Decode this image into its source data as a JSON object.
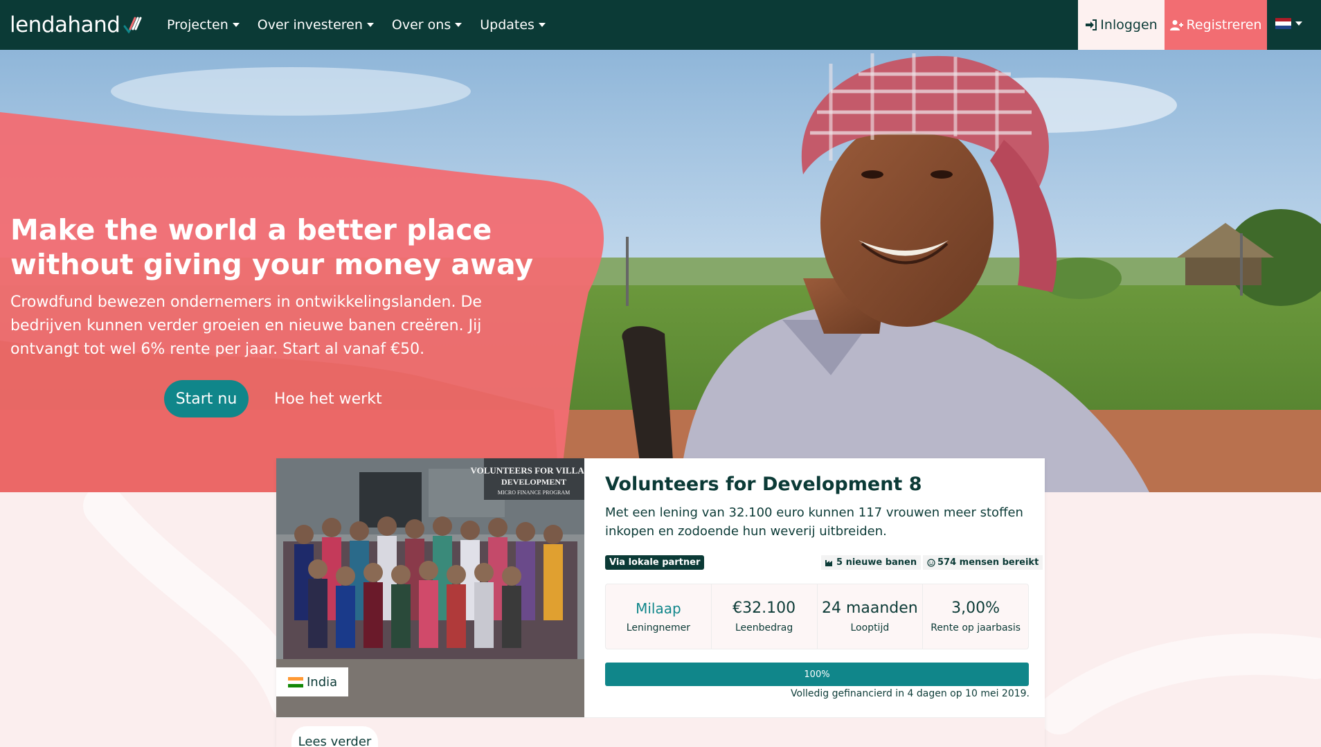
{
  "brand": {
    "name": "lendahand"
  },
  "nav": {
    "items": [
      {
        "label": "Projecten"
      },
      {
        "label": "Over investeren"
      },
      {
        "label": "Over ons"
      },
      {
        "label": "Updates"
      }
    ],
    "login": "Inloggen",
    "register": "Registreren",
    "language": "NL"
  },
  "hero": {
    "title": "Make the world a better place without giving your money away",
    "subtitle": "Crowdfund bewezen ondernemers in ontwikkelingslanden. De bedrijven kunnen verder groeien en nieuwe banen creëren. Jij ontvangt tot wel 6% rente per jaar. Start al vanaf €50.",
    "cta_primary": "Start nu",
    "cta_secondary": "Hoe het werkt"
  },
  "project": {
    "title": "Volunteers for Development 8",
    "description": "Met een lening van 32.100 euro kunnen 117 vrouwen meer stoffen inkopen en zodoende hun weverij uitbreiden.",
    "country": "India",
    "photo_sign_lines": [
      "VOLUNTEERS FOR VILLAGE",
      "DEVELOPMENT",
      "MICRO FINANCE PROGRAM"
    ],
    "badge_partner": "Via lokale partner",
    "badge_jobs": "5 nieuwe banen",
    "badge_reach": "574 mensen bereikt",
    "stats": [
      {
        "value": "Milaap",
        "label": "Leningnemer"
      },
      {
        "value": "€32.100",
        "label": "Leenbedrag"
      },
      {
        "value": "24 maanden",
        "label": "Looptijd"
      },
      {
        "value": "3,00%",
        "label": "Rente op jaarbasis"
      }
    ],
    "progress": 100,
    "progress_label": "100%",
    "funded_text": "Volledig gefinancierd in 4 dagen op 10 mei 2019.",
    "read_more": "Lees verder"
  },
  "colors": {
    "navy": "#0b3a36",
    "coral": "#f26d72",
    "teal": "#10868a",
    "pink_bg": "#fbeeee"
  }
}
